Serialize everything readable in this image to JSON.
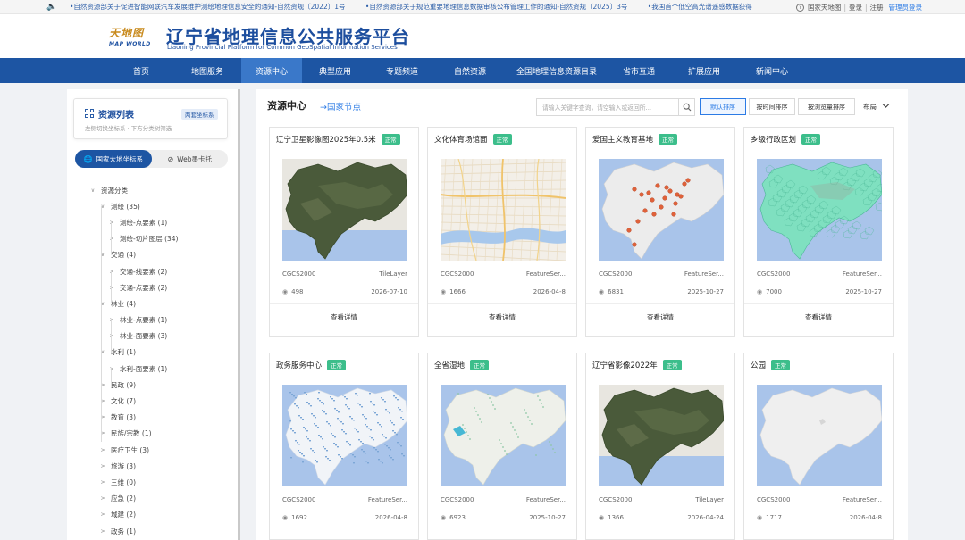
{
  "notice": {
    "speaker_icon": "speaker-icon",
    "items": [
      "•自然资源部关于促进智能网联汽车发展维护测绘地理信息安全的通知-自然资规〔2022〕1号",
      "•自然资源部关于规范重要地理信息数据审核公布管理工作的通知-自然资规〔2025〕3号",
      "•我国首个低空高光谱遥感数据获得"
    ],
    "help_icon": "question-circle-icon",
    "site_label": "国家天地图",
    "login": "登录",
    "register": "注册",
    "admin_login": "管理员登录",
    "sep": "|"
  },
  "header": {
    "logo_cn": "天地图",
    "logo_en": "MAP WORLD",
    "title_cn": "辽宁省地理信息公共服务平台",
    "title_en": "Liaoning Provincial Platform for Common GeoSpatial Information Services"
  },
  "nav": {
    "items": [
      {
        "label": "首页"
      },
      {
        "label": "地图服务"
      },
      {
        "label": "资源中心"
      },
      {
        "label": "典型应用"
      },
      {
        "label": "专题频道"
      },
      {
        "label": "自然资源"
      },
      {
        "label": "全国地理信息资源目录"
      },
      {
        "label": "省市互通"
      },
      {
        "label": "扩展应用"
      },
      {
        "label": "新闻中心"
      }
    ],
    "active": "资源中心"
  },
  "sidebar": {
    "title": "资源列表",
    "badge": "两套坐标系",
    "subtitle": "左侧切换坐标系 · 下方分类树筛选",
    "coord_tabs": [
      {
        "label": "国家大地坐标系",
        "icon": "globe-icon"
      },
      {
        "label": "Web墨卡托",
        "icon": "compass-icon"
      }
    ],
    "tree": [
      {
        "label": "资源分类",
        "level": 0,
        "caret": "∨"
      },
      {
        "label": "测绘 (35)",
        "level": 1,
        "caret": "∨"
      },
      {
        "label": "测绘-点要素 (1)",
        "level": 2,
        "caret": ">"
      },
      {
        "label": "测绘-切片图层 (34)",
        "level": 2,
        "caret": ">"
      },
      {
        "label": "交通 (4)",
        "level": 1,
        "caret": "∨"
      },
      {
        "label": "交通-线要素 (2)",
        "level": 2,
        "caret": ">"
      },
      {
        "label": "交通-点要素 (2)",
        "level": 2,
        "caret": ">"
      },
      {
        "label": "林业 (4)",
        "level": 1,
        "caret": "∨"
      },
      {
        "label": "林业-点要素 (1)",
        "level": 2,
        "caret": ">"
      },
      {
        "label": "林业-面要素 (3)",
        "level": 2,
        "caret": ">"
      },
      {
        "label": "水利 (1)",
        "level": 1,
        "caret": "∨"
      },
      {
        "label": "水利-面要素 (1)",
        "level": 2,
        "caret": ">"
      },
      {
        "label": "民政 (9)",
        "level": 1,
        "caret": ">"
      },
      {
        "label": "文化 (7)",
        "level": 1,
        "caret": ">"
      },
      {
        "label": "教育 (3)",
        "level": 1,
        "caret": ">"
      },
      {
        "label": "民族/宗教 (1)",
        "level": 1,
        "caret": ">"
      },
      {
        "label": "医疗卫生 (3)",
        "level": 1,
        "caret": ">"
      },
      {
        "label": "旅游 (3)",
        "level": 1,
        "caret": ">"
      },
      {
        "label": "三维 (0)",
        "level": 1,
        "caret": ">"
      },
      {
        "label": "应急 (2)",
        "level": 1,
        "caret": ">"
      },
      {
        "label": "城建 (2)",
        "level": 1,
        "caret": ">"
      },
      {
        "label": "政务 (1)",
        "level": 1,
        "caret": ">"
      }
    ]
  },
  "main": {
    "title": "资源中心",
    "node_link": "→国家节点",
    "search_placeholder": "请输入关键字查询，请空输入或返回所...",
    "search_icon": "search-icon",
    "sort_buttons": [
      {
        "label": "默认排序",
        "active": true
      },
      {
        "label": "按时间排序",
        "active": false
      },
      {
        "label": "按浏览量排序",
        "active": false
      }
    ],
    "layout_label": "布局",
    "layout_icon": "chevron-down-icon",
    "detail_label": "查看详情",
    "cards": [
      {
        "title": "辽宁卫星影像图2025年0.5米",
        "status": "正常",
        "crs": "CGCS2000",
        "type": "TileLayer",
        "views": "498",
        "date": "2026-07-10",
        "thumb": "satellite"
      },
      {
        "title": "文化体育场馆面",
        "status": "正常",
        "crs": "CGCS2000",
        "type": "FeatureSer...",
        "views": "1666",
        "date": "2026-04-8",
        "thumb": "street"
      },
      {
        "title": "爱国主义教育基地",
        "status": "正常",
        "crs": "CGCS2000",
        "type": "FeatureSer...",
        "views": "6831",
        "date": "2025-10-27",
        "thumb": "points"
      },
      {
        "title": "乡级行政区划",
        "status": "正常",
        "crs": "CGCS2000",
        "type": "FeatureSer...",
        "views": "7000",
        "date": "2025-10-27",
        "thumb": "admin"
      },
      {
        "title": "政务服务中心",
        "status": "正常",
        "crs": "CGCS2000",
        "type": "FeatureSer...",
        "views": "1692",
        "date": "2026-04-8",
        "thumb": "dots"
      },
      {
        "title": "全省湿地",
        "status": "正常",
        "crs": "CGCS2000",
        "type": "FeatureSer...",
        "views": "6923",
        "date": "2025-10-27",
        "thumb": "wetland"
      },
      {
        "title": "辽宁省影像2022年",
        "status": "正常",
        "crs": "CGCS2000",
        "type": "TileLayer",
        "views": "1366",
        "date": "2026-04-24",
        "thumb": "satellite"
      },
      {
        "title": "公园",
        "status": "正常",
        "crs": "CGCS2000",
        "type": "FeatureSer...",
        "views": "1717",
        "date": "2026-04-8",
        "thumb": "plain"
      }
    ]
  },
  "colors": {
    "nav_bg": "#1d55a3",
    "nav_active": "#3a78c9",
    "brand_blue": "#1d4e9e",
    "status_green": "#3cbe8b",
    "link_blue": "#2c7be5"
  }
}
